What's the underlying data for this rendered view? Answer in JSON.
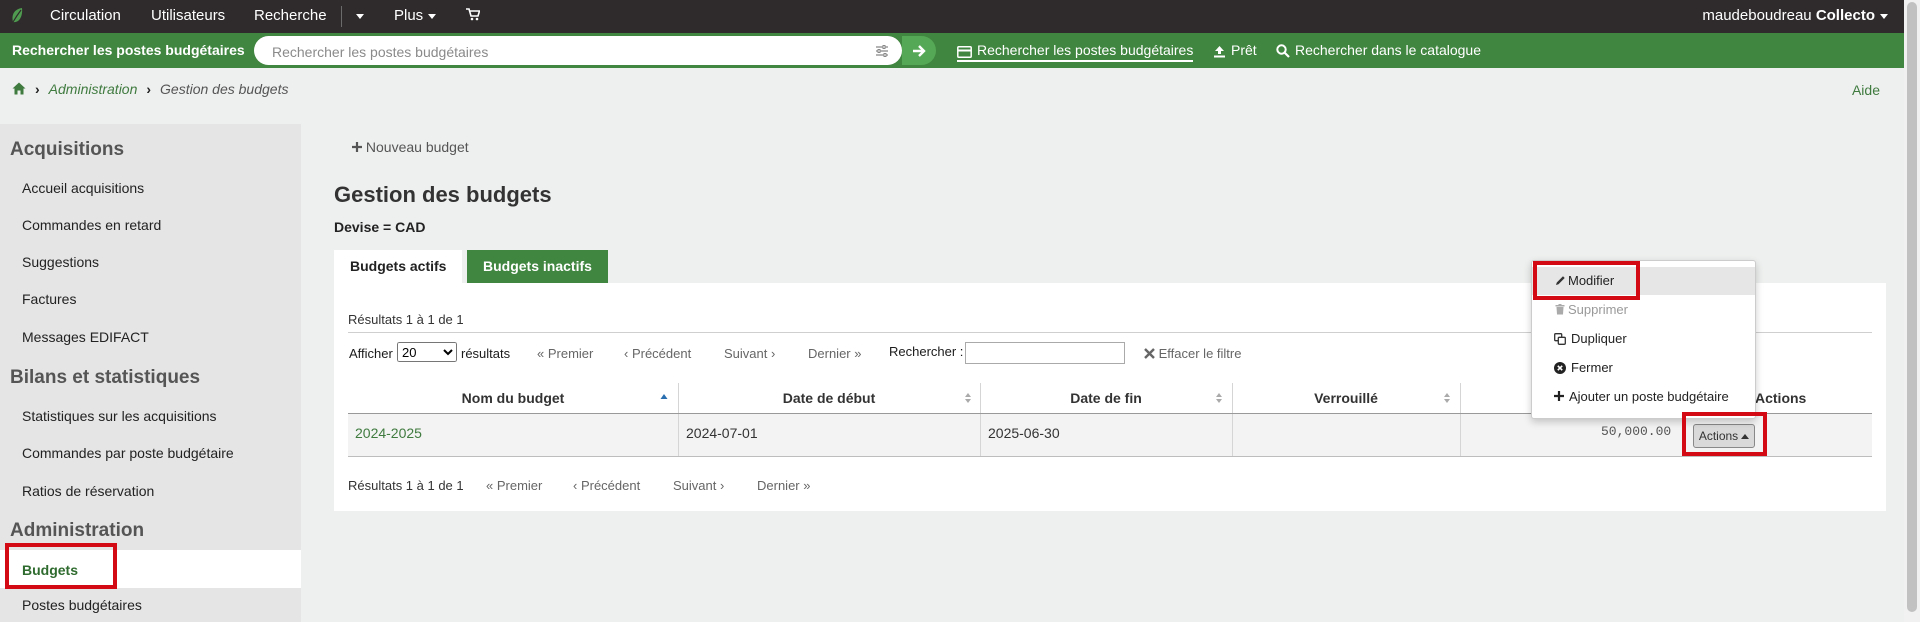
{
  "topnav": {
    "items": [
      "Circulation",
      "Utilisateurs",
      "Recherche",
      "Plus"
    ],
    "user": "maudeboudreau",
    "library": "Collecto"
  },
  "searchbar": {
    "label": "Rechercher les postes budgétaires",
    "placeholder": "Rechercher les postes budgétaires",
    "links": [
      "Rechercher les postes budgétaires",
      "Prêt",
      "Rechercher dans le catalogue"
    ]
  },
  "breadcrumb": [
    "Administration",
    "Gestion des budgets"
  ],
  "help": "Aide",
  "sidebar": {
    "sections": [
      {
        "heading": "Acquisitions",
        "items": [
          "Accueil acquisitions",
          "Commandes en retard",
          "Suggestions",
          "Factures",
          "Messages EDIFACT"
        ]
      },
      {
        "heading": "Bilans et statistiques",
        "items": [
          "Statistiques sur les acquisitions",
          "Commandes par poste budgétaire",
          "Ratios de réservation"
        ]
      },
      {
        "heading": "Administration",
        "items": [
          "Budgets",
          "Postes budgétaires"
        ]
      }
    ]
  },
  "main": {
    "new_budget": "Nouveau budget",
    "title": "Gestion des budgets",
    "currency_label": "Devise",
    "currency_value": "CAD",
    "tabs": [
      "Budgets actifs",
      "Budgets inactifs"
    ],
    "results_info": "Résultats 1 à 1 de 1",
    "show_label": "Afficher",
    "page_size": "20",
    "results_label": "résultats",
    "pager": [
      "Premier",
      "Précédent",
      "Suivant",
      "Dernier"
    ],
    "search_label": "Rechercher :",
    "clear_filter": "Effacer le filtre",
    "columns": [
      "Nom du budget",
      "Date de début",
      "Date de fin",
      "Verrouillé",
      "Actions"
    ],
    "rows": [
      {
        "name": "2024-2025",
        "start": "2024-07-01",
        "end": "2025-06-30",
        "locked": "",
        "total": "50,000.00"
      }
    ],
    "actions_button": "Actions",
    "dropdown": [
      "Modifier",
      "Supprimer",
      "Dupliquer",
      "Fermer",
      "Ajouter un poste budgétaire"
    ]
  }
}
